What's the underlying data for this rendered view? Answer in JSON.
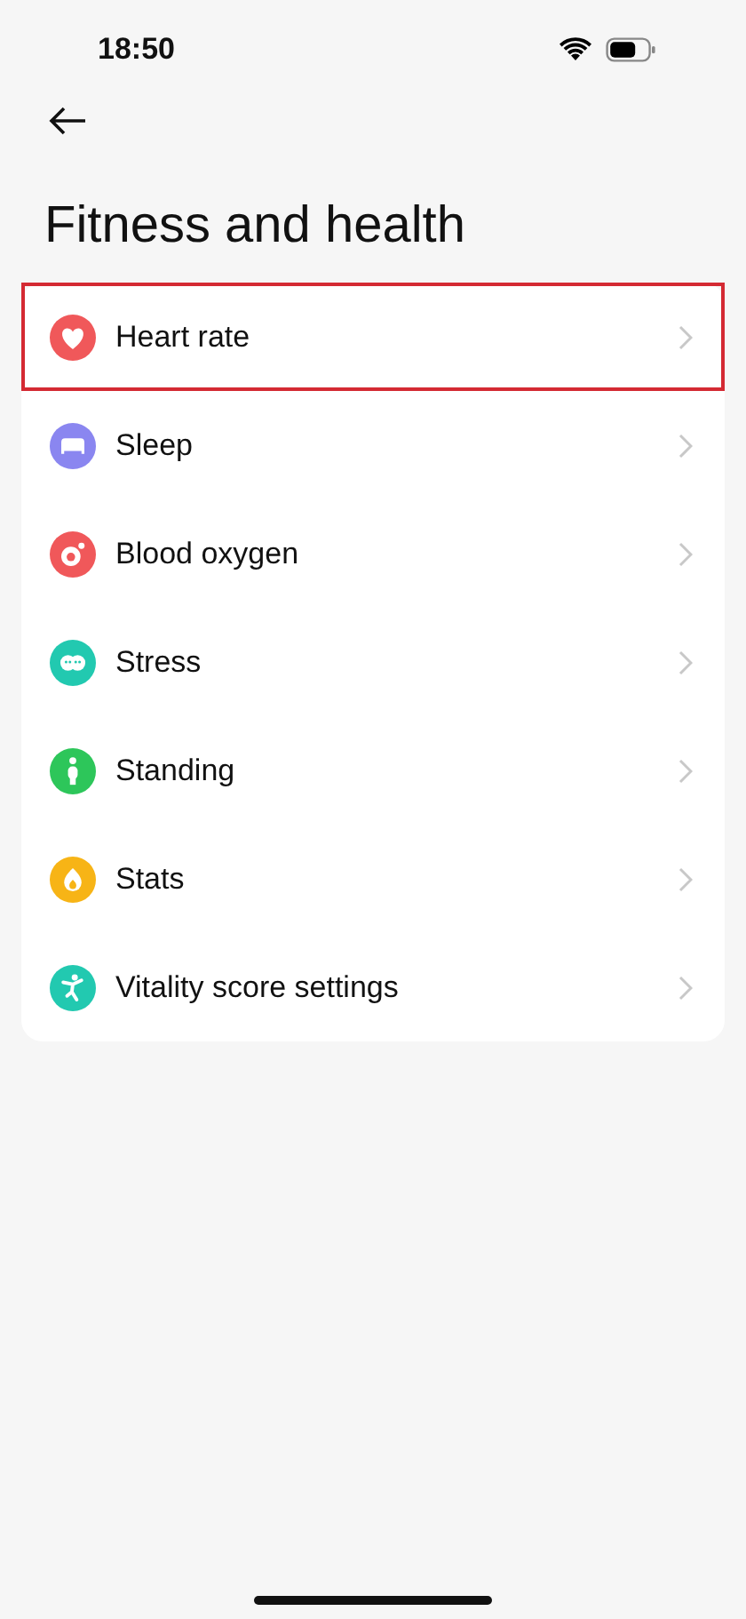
{
  "status_bar": {
    "time": "18:50"
  },
  "title": "Fitness and health",
  "items": [
    {
      "label": "Heart rate",
      "kind": "heart",
      "color": "#f0585a",
      "highlighted": true
    },
    {
      "label": "Sleep",
      "kind": "bed",
      "color": "#8a86f0",
      "highlighted": false
    },
    {
      "label": "Blood oxygen",
      "kind": "oxygen",
      "color": "#f0585a",
      "highlighted": false
    },
    {
      "label": "Stress",
      "kind": "faces",
      "color": "#22c9b0",
      "highlighted": false
    },
    {
      "label": "Standing",
      "kind": "person",
      "color": "#2dc65a",
      "highlighted": false
    },
    {
      "label": "Stats",
      "kind": "flame",
      "color": "#f7b416",
      "highlighted": false
    },
    {
      "label": "Vitality score settings",
      "kind": "figure",
      "color": "#22c9b0",
      "highlighted": false
    }
  ]
}
